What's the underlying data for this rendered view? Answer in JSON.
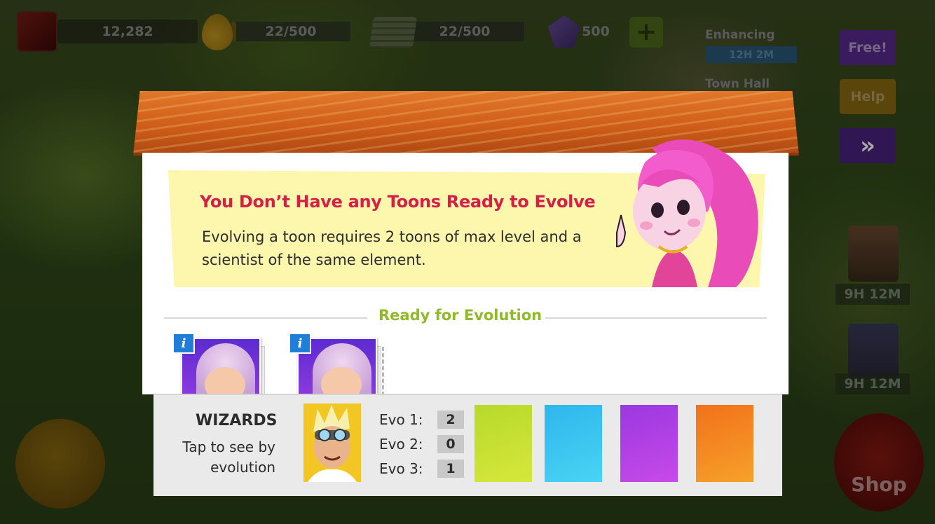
{
  "hud": {
    "trophies": "12,282",
    "elixir": "22/500",
    "elixir_fill": 0.044,
    "cash": "22/500",
    "cash_fill": 0.044,
    "gems": "500",
    "add_gems_symbol": "+"
  },
  "side_panel": {
    "enhancing_label": "Enhancing",
    "enhancing_timer": "12H 2M",
    "town_hall_label": "Town Hall",
    "free_button": "Free!",
    "help_button": "Help",
    "forward_button": "»",
    "timer_1": "9H 12M",
    "timer_2": "9H 12M",
    "shop_button": "Shop"
  },
  "modal": {
    "notice_title": "You Don’t Have any Toons Ready to Evolve",
    "notice_text": "Evolving a toon requires 2 toons of max level and a scientist of the same element.",
    "section_title": "Ready for Evolution",
    "info_symbol": "i"
  },
  "footer": {
    "category": "WIZARDS",
    "subtitle": "Tap to see by evolution",
    "evo": [
      {
        "label": "Evo 1:",
        "value": "2"
      },
      {
        "label": "Evo 2:",
        "value": "0"
      },
      {
        "label": "Evo 3:",
        "value": "1"
      }
    ],
    "element_colors": [
      "#b7d92b",
      "#2fb6ec",
      "#9a38e0",
      "#f2711a"
    ]
  },
  "colors": {
    "title_red": "#d51f48",
    "section_green": "#8fbb2a",
    "roof_orange": "#d8661c"
  }
}
